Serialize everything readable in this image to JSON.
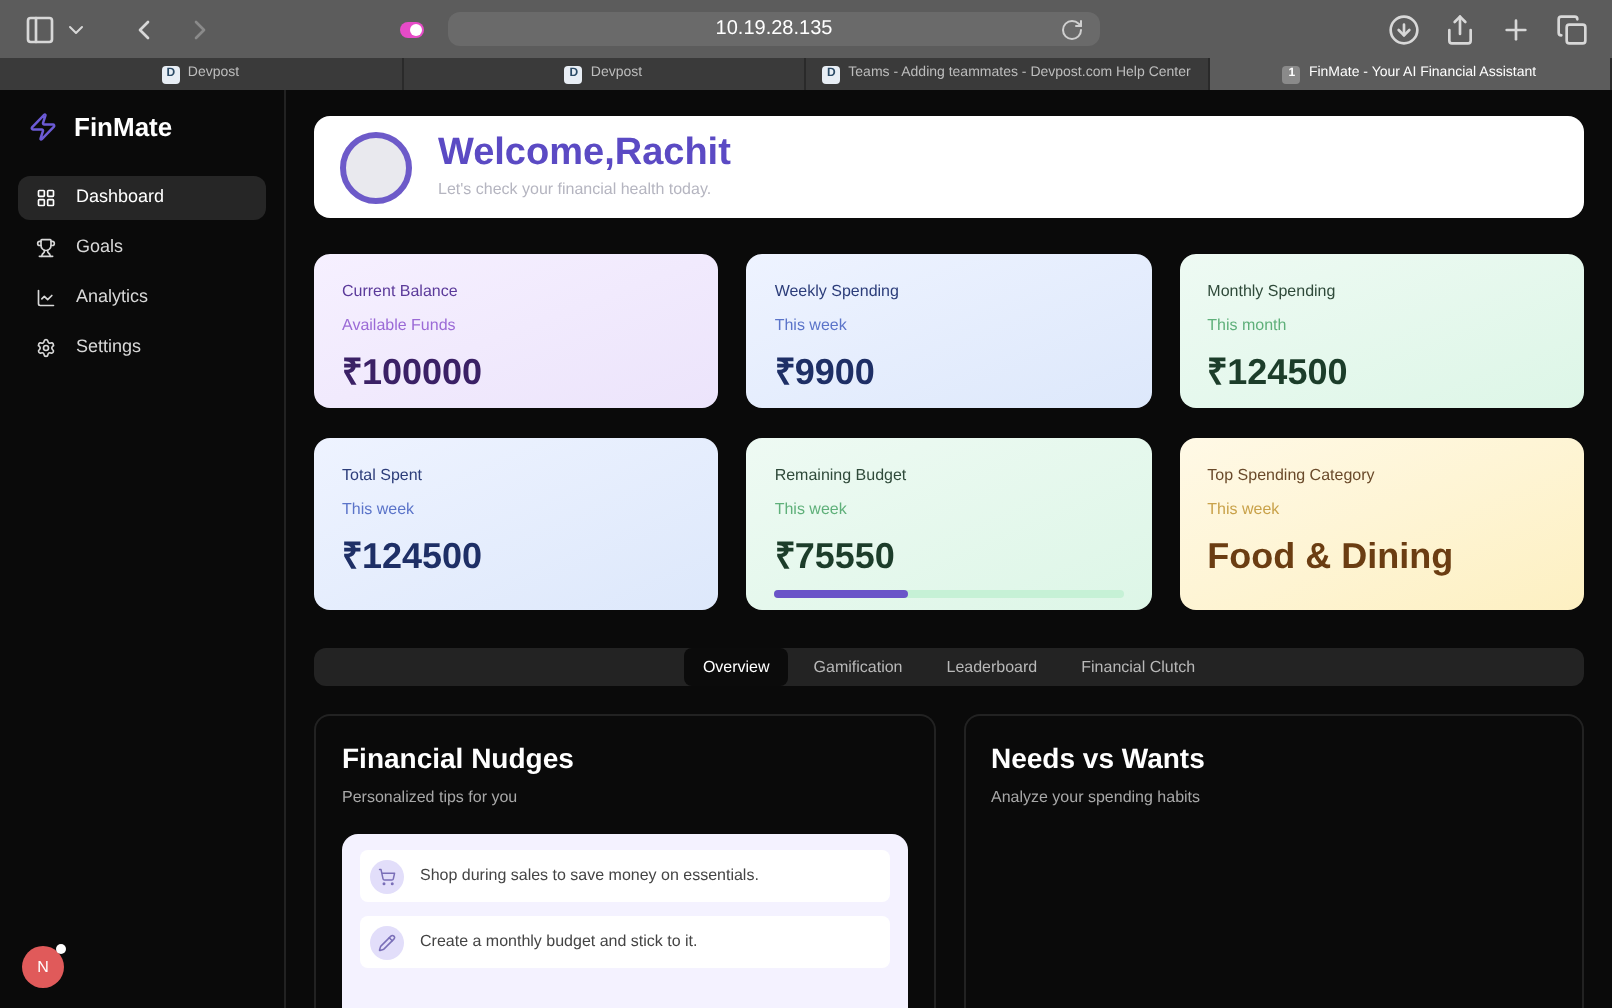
{
  "browser": {
    "address": "10.19.28.135",
    "tabs": [
      {
        "title": "Devpost",
        "favicon": "D",
        "selected": false
      },
      {
        "title": "Devpost",
        "favicon": "D",
        "selected": false
      },
      {
        "title": "Teams - Adding teammates - Devpost.com Help Center",
        "favicon": "D",
        "selected": false
      },
      {
        "title": "FinMate - Your AI Financial Assistant",
        "favicon": "1",
        "selected": true
      }
    ]
  },
  "sidebar": {
    "brand": "FinMate",
    "items": [
      {
        "label": "Dashboard",
        "selected": true
      },
      {
        "label": "Goals",
        "selected": false
      },
      {
        "label": "Analytics",
        "selected": false
      },
      {
        "label": "Settings",
        "selected": false
      }
    ],
    "avatar": {
      "initial": "N",
      "online": true
    }
  },
  "welcome": {
    "title": "Welcome,Rachit",
    "subtitle": "Let's check your financial health today."
  },
  "stats": [
    {
      "title": "Current Balance",
      "period": "Available Funds",
      "value": "₹100000",
      "kind": "purple"
    },
    {
      "title": "Weekly Spending",
      "period": "This week",
      "value": "₹9900",
      "kind": "blue"
    },
    {
      "title": "Monthly Spending",
      "period": "This month",
      "value": "₹124500",
      "kind": "green"
    },
    {
      "title": "Total Spent",
      "period": "This week",
      "value": "₹124500",
      "kind": "blue"
    },
    {
      "title": "Remaining Budget",
      "period": "This week",
      "value": "₹75550",
      "kind": "green",
      "level": 0.38
    },
    {
      "title": "Top Spending Category",
      "period": "This week",
      "value": "Food & Dining",
      "kind": "yellow"
    }
  ],
  "tabs": [
    {
      "label": "Overview",
      "selected": true
    },
    {
      "label": "Gamification",
      "selected": false
    },
    {
      "label": "Leaderboard",
      "selected": false
    },
    {
      "label": "Financial Clutch",
      "selected": false
    }
  ],
  "nudges": {
    "title": "Financial Nudges",
    "subtitle": "Personalized tips for you",
    "items": [
      "Shop during sales to save money on essentials.",
      "Create a monthly budget and stick to it."
    ]
  },
  "needs_wants": {
    "title": "Needs vs Wants",
    "subtitle": "Analyze your spending habits"
  }
}
